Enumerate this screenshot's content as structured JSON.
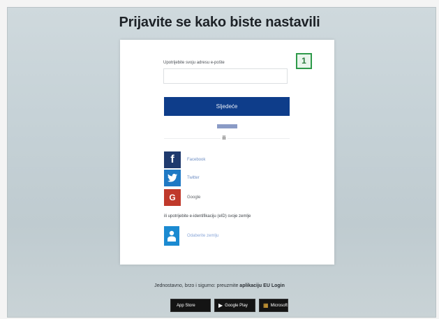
{
  "page": {
    "headline": "Prijavite se kako biste nastavili",
    "badge": "1"
  },
  "login": {
    "email_label": "Upotrijebite svoju adresu e-pošte",
    "email_value": "",
    "next_label": "Sljedeće",
    "create_account": "Izradi račun",
    "divider": "ili"
  },
  "social": [
    {
      "label": "Facebook",
      "icon": "facebook-icon",
      "color": "#1f3a6e"
    },
    {
      "label": "Twitter",
      "icon": "twitter-icon",
      "color": "#1f79c4"
    },
    {
      "label": "Google",
      "icon": "google-icon",
      "color": "#c0392b"
    }
  ],
  "eid": {
    "text": "ili upotrijebite e-identifikaciju (eID) svoje zemlje",
    "label": "Odaberite zemlju",
    "icon": "person-icon"
  },
  "footer": {
    "prefix": "Jednostavno, brzo i sigurno: preuzmite ",
    "app": "aplikaciju EU Login",
    "stores": [
      {
        "label": "App Store",
        "icon": "apple-icon"
      },
      {
        "label": "Google Play",
        "icon": "play-icon"
      },
      {
        "label": "Microsoft",
        "icon": "windows-icon"
      }
    ]
  }
}
